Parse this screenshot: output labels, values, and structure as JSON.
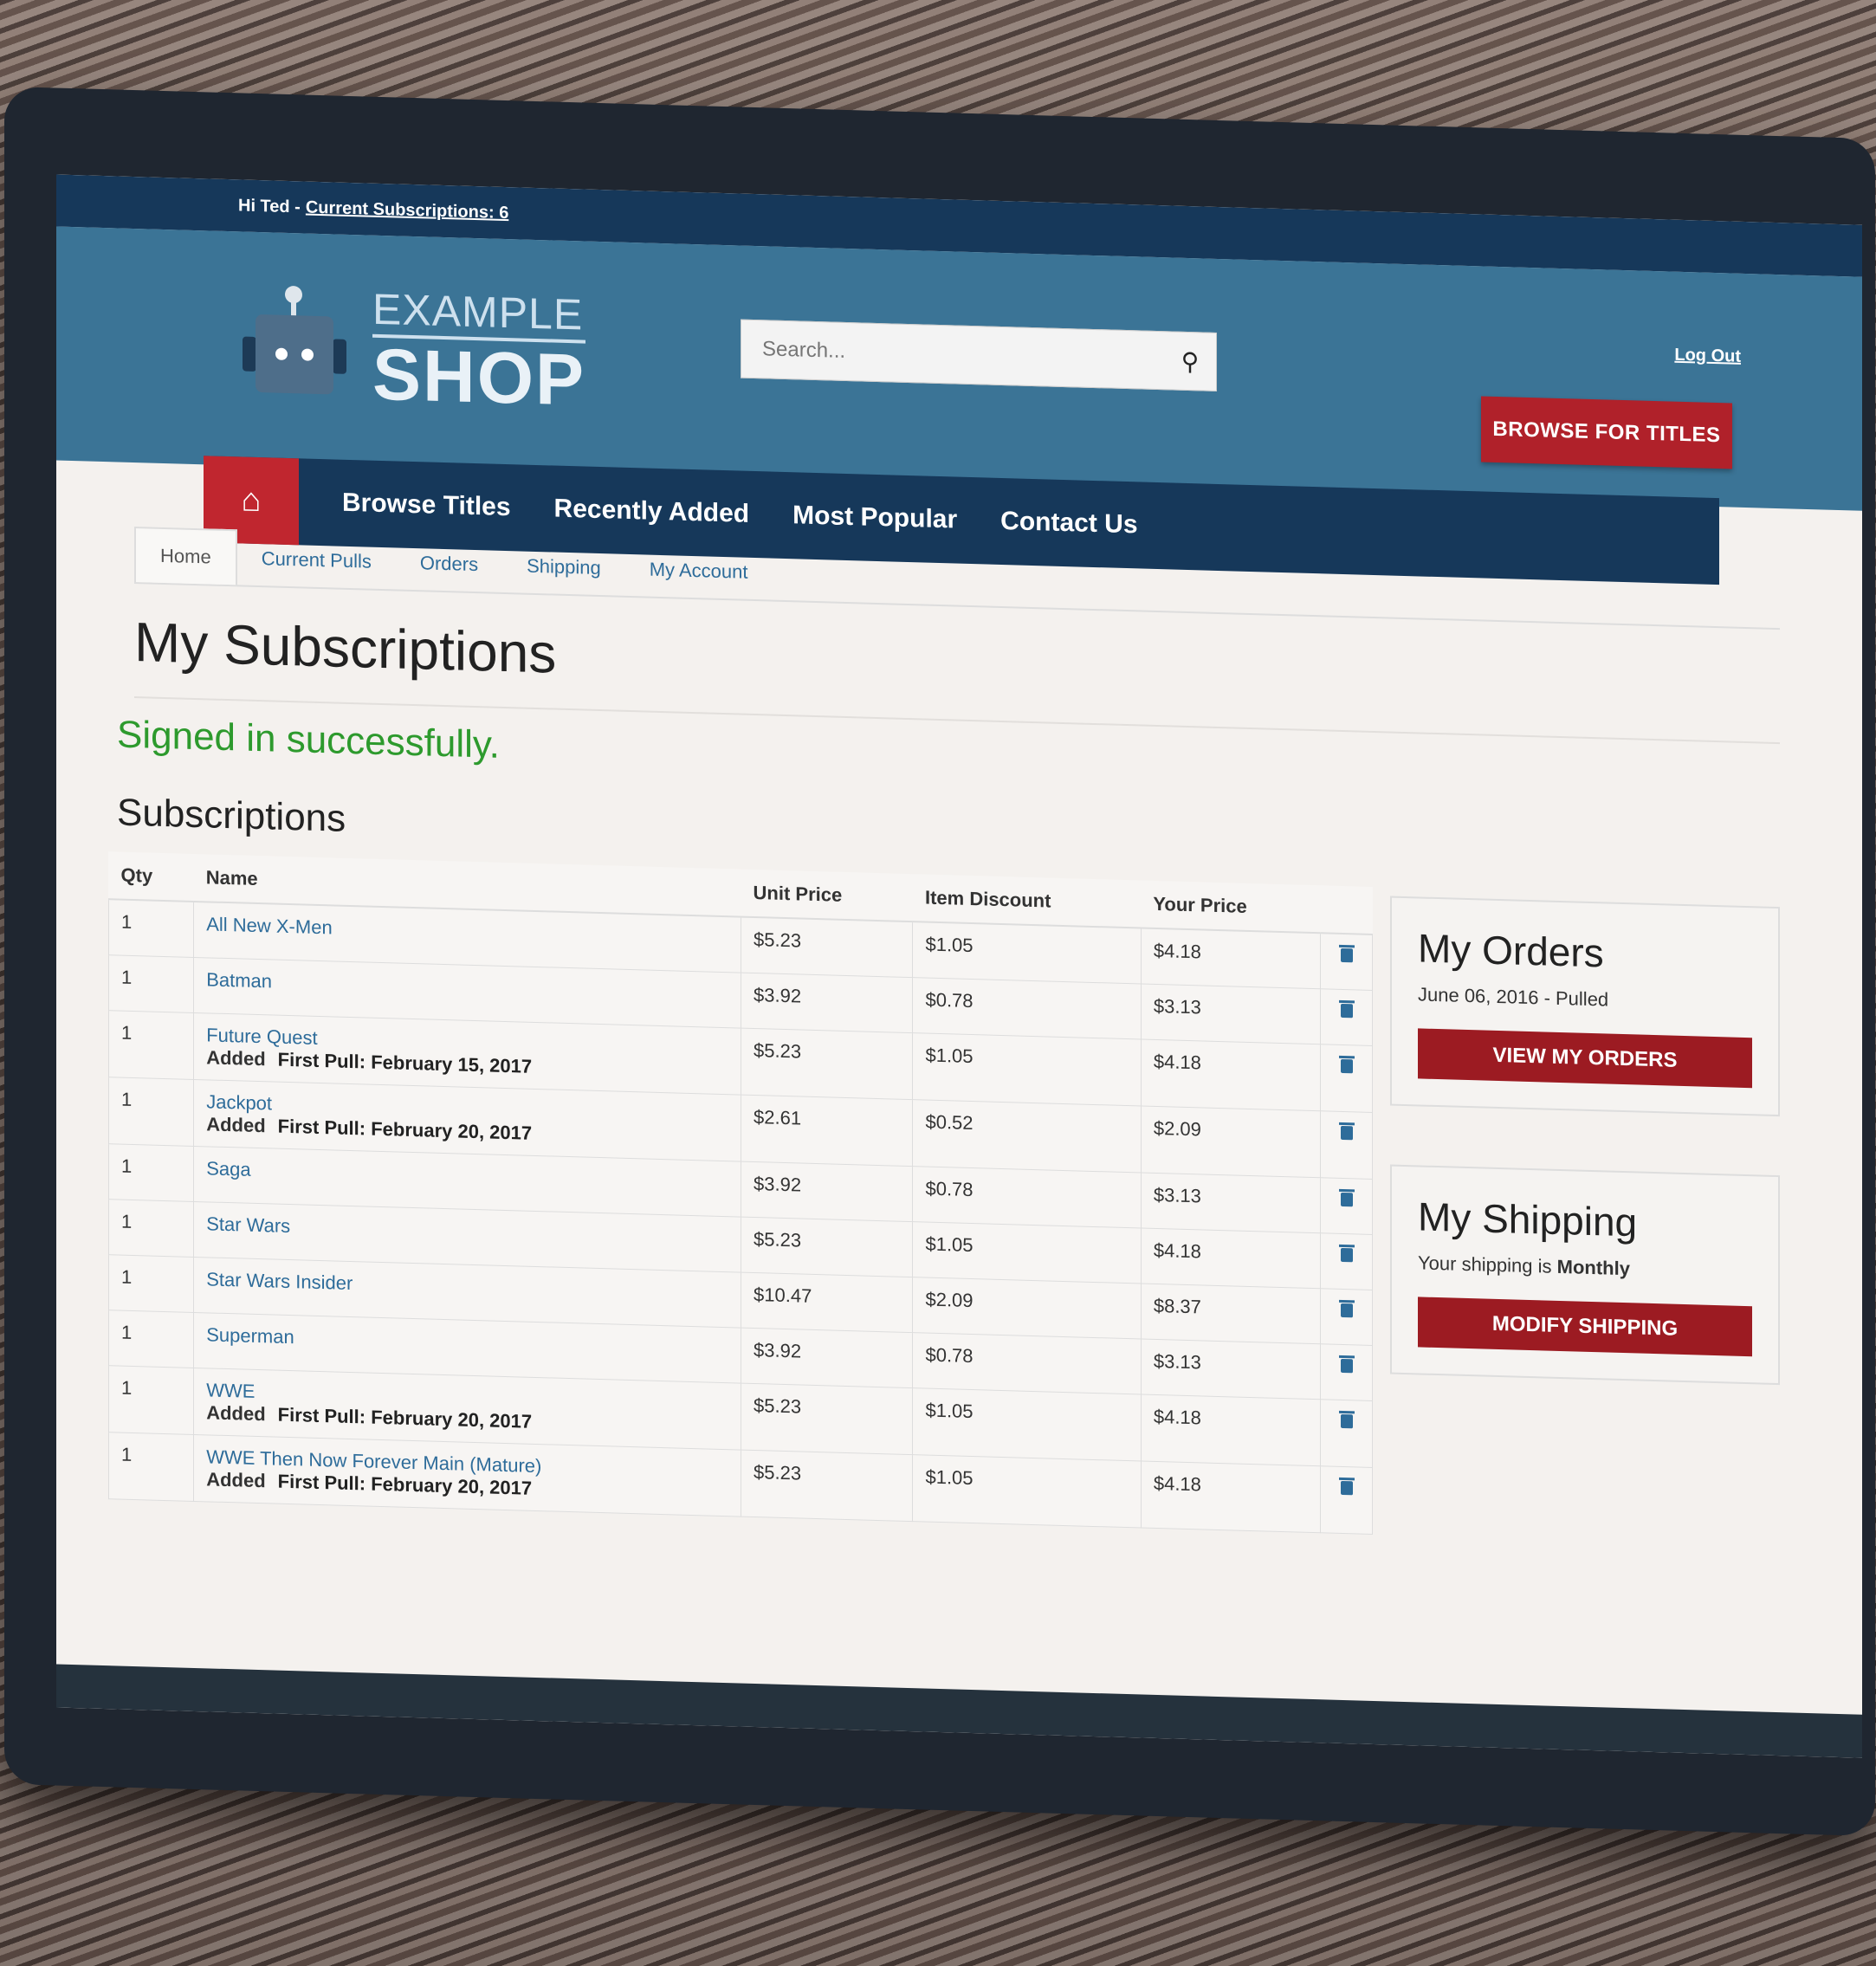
{
  "topbar": {
    "greeting": "Hi Ted -",
    "subscriptions_link": "Current Subscriptions: 6"
  },
  "header": {
    "logo_line1": "EXAMPLE",
    "logo_line2": "SHOP",
    "search_placeholder": "Search...",
    "logout": "Log Out",
    "browse_button": "BROWSE FOR TITLES"
  },
  "nav": {
    "items": [
      "Browse Titles",
      "Recently Added",
      "Most Popular",
      "Contact Us"
    ]
  },
  "tabs": [
    "Home",
    "Current Pulls",
    "Orders",
    "Shipping",
    "My Account"
  ],
  "page": {
    "title": "My Subscriptions",
    "flash": "Signed in successfully.",
    "section_title": "Subscriptions"
  },
  "table": {
    "headers": [
      "Qty",
      "Name",
      "Unit Price",
      "Item Discount",
      "Your Price",
      ""
    ],
    "rows": [
      {
        "qty": "1",
        "name": "All New X-Men",
        "added": "",
        "pull": "",
        "unit": "$5.23",
        "discount": "$1.05",
        "price": "$4.18"
      },
      {
        "qty": "1",
        "name": "Batman",
        "added": "",
        "pull": "",
        "unit": "$3.92",
        "discount": "$0.78",
        "price": "$3.13"
      },
      {
        "qty": "1",
        "name": "Future Quest",
        "added": "Added",
        "pull": "First Pull: February 15, 2017",
        "unit": "$5.23",
        "discount": "$1.05",
        "price": "$4.18"
      },
      {
        "qty": "1",
        "name": "Jackpot",
        "added": "Added",
        "pull": "First Pull: February 20, 2017",
        "unit": "$2.61",
        "discount": "$0.52",
        "price": "$2.09"
      },
      {
        "qty": "1",
        "name": "Saga",
        "added": "",
        "pull": "",
        "unit": "$3.92",
        "discount": "$0.78",
        "price": "$3.13"
      },
      {
        "qty": "1",
        "name": "Star Wars",
        "added": "",
        "pull": "",
        "unit": "$5.23",
        "discount": "$1.05",
        "price": "$4.18"
      },
      {
        "qty": "1",
        "name": "Star Wars Insider",
        "added": "",
        "pull": "",
        "unit": "$10.47",
        "discount": "$2.09",
        "price": "$8.37"
      },
      {
        "qty": "1",
        "name": "Superman",
        "added": "",
        "pull": "",
        "unit": "$3.92",
        "discount": "$0.78",
        "price": "$3.13"
      },
      {
        "qty": "1",
        "name": "WWE",
        "added": "Added",
        "pull": "First Pull: February 20, 2017",
        "unit": "$5.23",
        "discount": "$1.05",
        "price": "$4.18"
      },
      {
        "qty": "1",
        "name": "WWE Then Now Forever Main (Mature)",
        "added": "Added",
        "pull": "First Pull: February 20, 2017",
        "unit": "$5.23",
        "discount": "$1.05",
        "price": "$4.18"
      }
    ]
  },
  "orders_panel": {
    "title": "My Orders",
    "info": "June 06, 2016 - Pulled",
    "button": "VIEW MY ORDERS"
  },
  "shipping_panel": {
    "title": "My Shipping",
    "info_prefix": "Your shipping is",
    "info_value": "Monthly",
    "button": "MODIFY SHIPPING"
  },
  "colors": {
    "header_blue": "#3b7496",
    "navy": "#16385a",
    "brand_red": "#b0212a",
    "success_green": "#2d9a2d",
    "link_blue": "#2e6c9a"
  },
  "icons": {
    "home": "home-icon",
    "search": "search-icon",
    "delete": "trash-icon"
  }
}
